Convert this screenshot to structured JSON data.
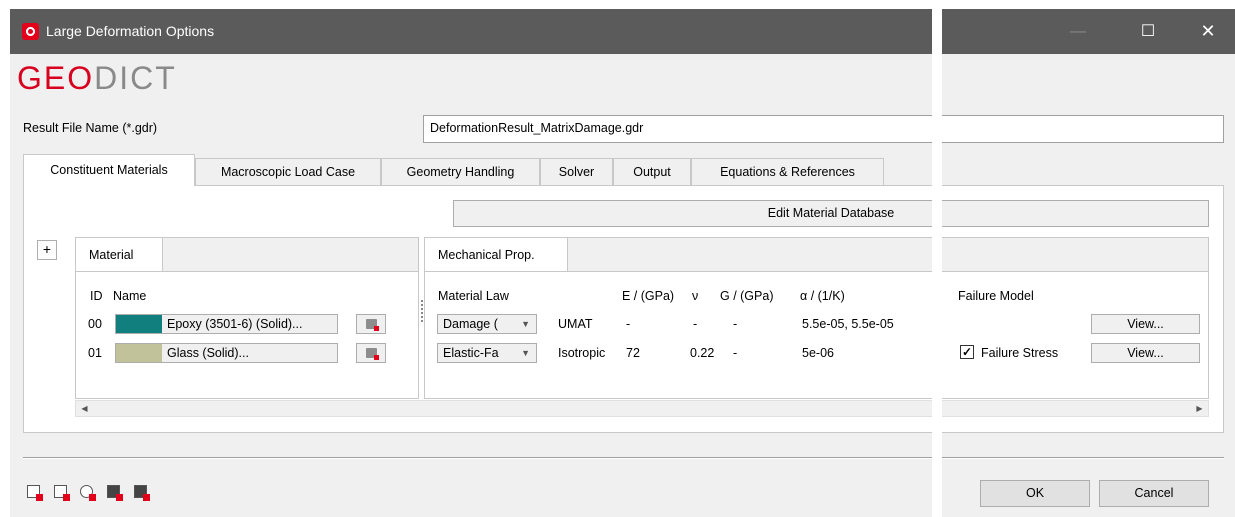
{
  "window": {
    "title": "Large Deformation Options",
    "logo_geo": "GEO",
    "logo_dict": "DICT"
  },
  "result_file": {
    "label": "Result File Name (*.gdr)",
    "value": "DeformationResult_MatrixDamage.gdr"
  },
  "tabs": [
    {
      "label": "Constituent Materials",
      "active": true
    },
    {
      "label": "Macroscopic Load Case"
    },
    {
      "label": "Geometry Handling"
    },
    {
      "label": "Solver"
    },
    {
      "label": "Output"
    },
    {
      "label": "Equations & References"
    }
  ],
  "edit_db_label": "Edit Material Database",
  "add_label": "+",
  "material_pane": {
    "tab_label": "Material",
    "col_id": "ID",
    "col_name": "Name",
    "rows": [
      {
        "id": "00",
        "name": "Epoxy (3501-6) (Solid)...",
        "color": "#127f7f"
      },
      {
        "id": "01",
        "name": "Glass (Solid)...",
        "color": "#c2c29a"
      }
    ]
  },
  "mech_pane": {
    "tab_label": "Mechanical Prop.",
    "headers": {
      "law": "Material Law",
      "e": "E / (GPa)",
      "nu": "ν",
      "g": "G / (GPa)",
      "alpha": "α / (1/K)",
      "failure": "Failure Model"
    },
    "rows": [
      {
        "law": "Damage (",
        "type": "UMAT",
        "e": "-",
        "nu": "-",
        "g": "-",
        "alpha": "5.5e-05, 5.5e-05",
        "failure_check": false,
        "failure_label": "",
        "view": "View..."
      },
      {
        "law": "Elastic-Fa",
        "type": "Isotropic",
        "e": "72",
        "nu": "0.22",
        "g": "-",
        "alpha": "5e-06",
        "failure_check": true,
        "failure_label": "Failure Stress",
        "view": "View..."
      }
    ]
  },
  "buttons": {
    "ok": "OK",
    "cancel": "Cancel"
  },
  "titlebar_icons": {
    "minimize": "—",
    "maximize": "☐",
    "close": "✕"
  }
}
